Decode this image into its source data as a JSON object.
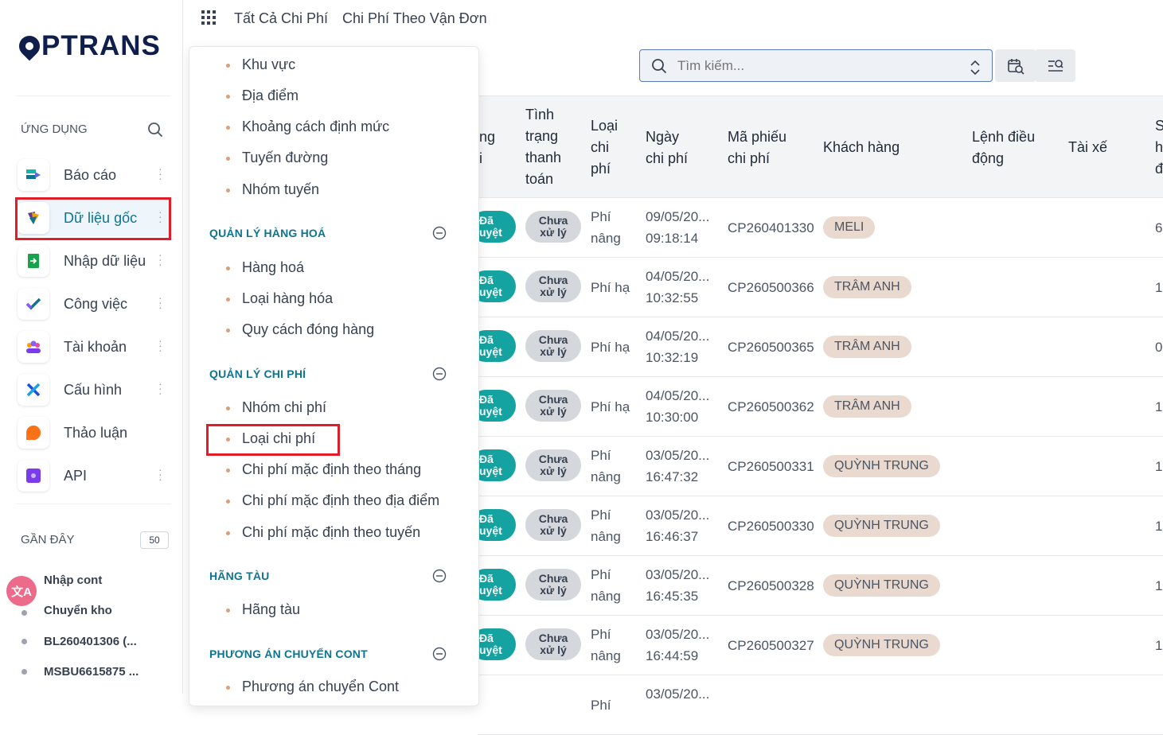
{
  "brand": {
    "logo_text": "PTRANS",
    "color": "#0f1e4a"
  },
  "sidebar": {
    "apps_title": "ỨNG DỤNG",
    "items": [
      {
        "label": "Báo cáo",
        "icon": "report-icon"
      },
      {
        "label": "Dữ liệu gốc",
        "icon": "master-data-icon"
      },
      {
        "label": "Nhập dữ liệu",
        "icon": "import-icon"
      },
      {
        "label": "Công việc",
        "icon": "task-icon"
      },
      {
        "label": "Tài khoản",
        "icon": "account-icon"
      },
      {
        "label": "Cấu hình",
        "icon": "settings-icon"
      },
      {
        "label": "Thảo luận",
        "icon": "discuss-icon"
      },
      {
        "label": "API",
        "icon": "api-icon"
      }
    ],
    "recent_title": "GẦN ĐÂY",
    "recent_count": "50",
    "recent": [
      "Nhập cont",
      "Chuyển kho",
      "BL260401306 (...",
      "MSBU6615875 ..."
    ]
  },
  "topbar": {
    "links": [
      "Tất Cả Chi Phí",
      "Chi Phí Theo Vận Đơn"
    ]
  },
  "search": {
    "placeholder": "Tìm kiếm..."
  },
  "dropdown": {
    "items_top": [
      "Khu vực",
      "Địa điểm",
      "Khoảng cách định mức",
      "Tuyến đường",
      "Nhóm tuyến"
    ],
    "sections": [
      {
        "title": "QUẢN LÝ HÀNG HOÁ",
        "items": [
          "Hàng hoá",
          "Loại hàng hóa",
          "Quy cách đóng hàng"
        ]
      },
      {
        "title": "QUẢN LÝ CHI PHÍ",
        "items": [
          "Nhóm chi phí",
          "Loại chi phí",
          "Chi phí mặc định theo tháng",
          "Chi phí mặc định theo địa điểm",
          "Chi phí mặc định theo tuyến"
        ]
      },
      {
        "title": "HÃNG TÀU",
        "items": [
          "Hãng tàu"
        ]
      },
      {
        "title": "PHƯƠNG ÁN CHUYỂN CONT",
        "items": [
          "Phương án chuyển Cont"
        ]
      }
    ]
  },
  "table": {
    "headers": {
      "approval_partial": "ng\ni",
      "payment_status": "Tình\ntrạng\nthanh\ntoán",
      "cost_type": "Loại\nchi\nphí",
      "cost_date": "Ngày\nchi phí",
      "voucher": "Mã phiếu\nchi phí",
      "customer": "Khách hàng",
      "dispatch": "Lệnh điều\nđộng",
      "driver": "Tài xế",
      "last_partial": "S\nh\nđ"
    },
    "rows": [
      {
        "approval": "Đã\nuyệt",
        "payment": "Chưa\nxử lý",
        "type": "Phí\nnâng",
        "date": "09/05/20...\n09:18:14",
        "voucher": "CP260401330",
        "customer": "MELI",
        "last": "6"
      },
      {
        "approval": "Đã\nuyệt",
        "payment": "Chưa\nxử lý",
        "type": "Phí hạ",
        "date": "04/05/20...\n10:32:55",
        "voucher": "CP260500366",
        "customer": "TRÂM ANH",
        "last": "1"
      },
      {
        "approval": "Đã\nuyệt",
        "payment": "Chưa\nxử lý",
        "type": "Phí hạ",
        "date": "04/05/20...\n10:32:19",
        "voucher": "CP260500365",
        "customer": "TRÂM ANH",
        "last": "0"
      },
      {
        "approval": "Đã\nuyệt",
        "payment": "Chưa\nxử lý",
        "type": "Phí hạ",
        "date": "04/05/20...\n10:30:00",
        "voucher": "CP260500362",
        "customer": "TRÂM ANH",
        "last": "1"
      },
      {
        "approval": "Đã\nuyệt",
        "payment": "Chưa\nxử lý",
        "type": "Phí\nnâng",
        "date": "03/05/20...\n16:47:32",
        "voucher": "CP260500331",
        "customer": "QUỲNH TRUNG",
        "last": "1"
      },
      {
        "approval": "Đã\nuyệt",
        "payment": "Chưa\nxử lý",
        "type": "Phí\nnâng",
        "date": "03/05/20...\n16:46:37",
        "voucher": "CP260500330",
        "customer": "QUỲNH TRUNG",
        "last": "1"
      },
      {
        "approval": "Đã\nuyệt",
        "payment": "Chưa\nxử lý",
        "type": "Phí\nnâng",
        "date": "03/05/20...\n16:45:35",
        "voucher": "CP260500328",
        "customer": "QUỲNH TRUNG",
        "last": "1"
      },
      {
        "approval": "Đã\nuyệt",
        "payment": "Chưa\nxử lý",
        "type": "Phí\nnâng",
        "date": "03/05/20...\n16:44:59",
        "voucher": "CP260500327",
        "customer": "QUỲNH TRUNG",
        "last": "1"
      },
      {
        "approval": "",
        "payment": "",
        "type": "Phí",
        "date": "03/05/20...",
        "voucher": "",
        "customer": "",
        "last": ""
      }
    ]
  },
  "colors": {
    "accent": "#0e7490",
    "approved": "#15a3a1",
    "pending": "#d4d7dc",
    "customer_tag": "#ead9cf",
    "highlight": "#e11d2a"
  }
}
